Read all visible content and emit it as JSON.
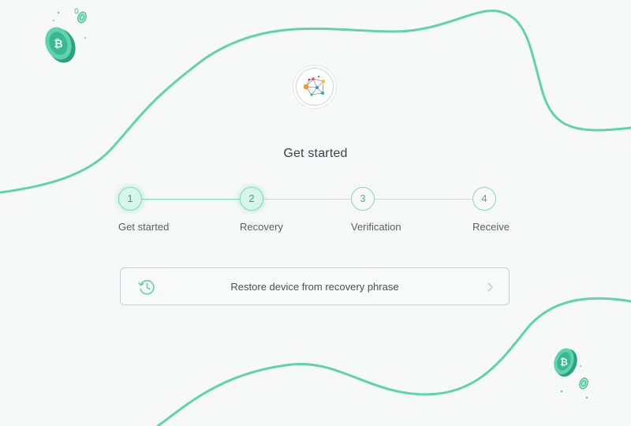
{
  "page": {
    "title": "Get started"
  },
  "steps": [
    {
      "number": "1",
      "label": "Get started",
      "state": "done"
    },
    {
      "number": "2",
      "label": "Recovery",
      "state": "current"
    },
    {
      "number": "3",
      "label": "Verification",
      "state": "upcoming"
    },
    {
      "number": "4",
      "label": "Receive",
      "state": "upcoming"
    }
  ],
  "actions": {
    "restore": {
      "label": "Restore device from recovery phrase",
      "icon": "history-icon",
      "trailing_icon": "chevron-right-icon"
    }
  },
  "colors": {
    "accent": "#5fd3ae",
    "accent_light": "#d8f5ea",
    "background": "#f7f8f8",
    "text": "#3b4249"
  },
  "decorations": [
    "bitcoin-coin-icon",
    "bitcoin-coin-icon"
  ],
  "logo": {
    "icon": "network-graph-logo-icon"
  }
}
